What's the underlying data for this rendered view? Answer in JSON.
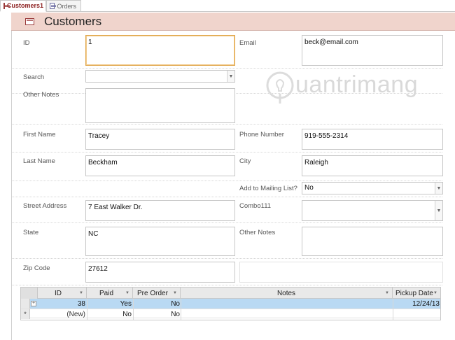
{
  "tabs": [
    {
      "label": "Customers1",
      "active": true
    },
    {
      "label": "Orders",
      "active": false
    }
  ],
  "header": {
    "title": "Customers",
    "background": "#f0d4cc"
  },
  "fields": {
    "id": {
      "label": "ID",
      "value": "1"
    },
    "email": {
      "label": "Email",
      "value": "beck@email.com"
    },
    "search": {
      "label": "Search",
      "value": ""
    },
    "other_notes_top": {
      "label": "Other Notes",
      "value": ""
    },
    "first_name": {
      "label": "First Name",
      "value": "Tracey"
    },
    "phone": {
      "label": "Phone Number",
      "value": "919-555-2314"
    },
    "last_name": {
      "label": "Last Name",
      "value": "Beckham"
    },
    "city": {
      "label": "City",
      "value": "Raleigh"
    },
    "mailing": {
      "label": "Add to Mailing List?",
      "value": "No"
    },
    "street": {
      "label": "Street Address",
      "value": "7 East Walker Dr."
    },
    "combo111": {
      "label": "Combo111",
      "value": ""
    },
    "state": {
      "label": "State",
      "value": "NC"
    },
    "other_notes": {
      "label": "Other Notes",
      "value": ""
    },
    "zip": {
      "label": "Zip Code",
      "value": "27612"
    }
  },
  "watermark": {
    "text": "uantrimang"
  },
  "subform": {
    "columns": [
      "ID",
      "Paid",
      "Pre Order",
      "Notes",
      "Pickup Date"
    ],
    "rows": [
      {
        "id": "38",
        "paid": "Yes",
        "pre_order": "No",
        "notes": "",
        "pickup_date": "12/24/13"
      },
      {
        "id": "(New)",
        "paid": "No",
        "pre_order": "No",
        "notes": "",
        "pickup_date": ""
      }
    ],
    "expander": "+",
    "new_row_marker": "*",
    "selected_color": "#b9d9f3"
  },
  "colors": {
    "focus_border": "#e0a64a",
    "tab_active_text": "#8a1c1c"
  }
}
